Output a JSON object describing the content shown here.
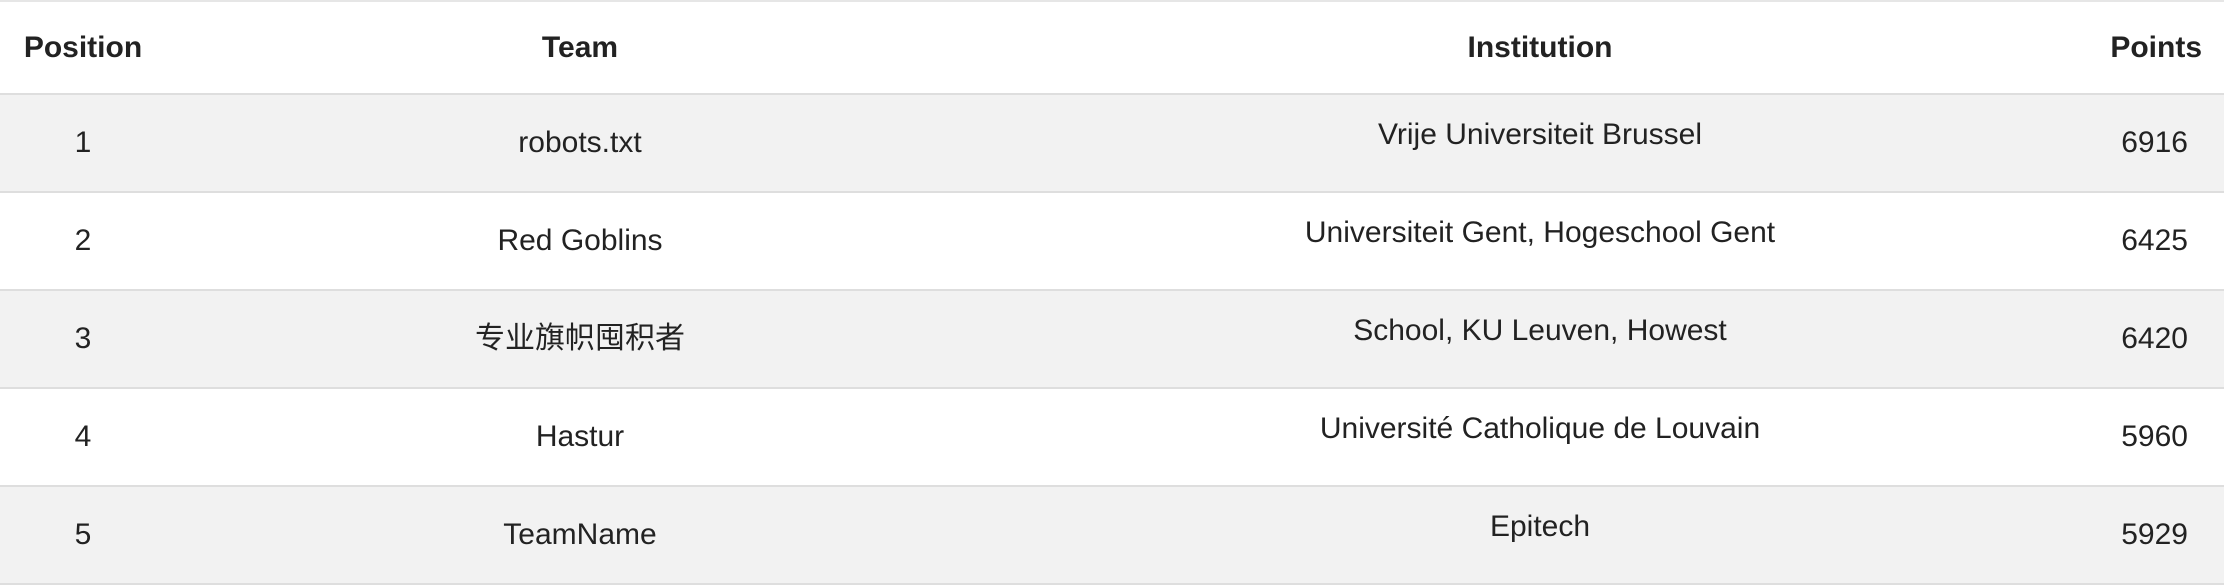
{
  "table": {
    "headers": {
      "position": "Position",
      "team": "Team",
      "institution": "Institution",
      "points": "Points"
    },
    "rows": [
      {
        "position": "1",
        "team": "robots.txt",
        "institution": "Vrije Universiteit Brussel",
        "points": "6916"
      },
      {
        "position": "2",
        "team": "Red Goblins",
        "institution": "Universiteit Gent, Hogeschool Gent",
        "points": "6425"
      },
      {
        "position": "3",
        "team": "专业旗帜囤积者",
        "institution": "School, KU Leuven, Howest",
        "points": "6420"
      },
      {
        "position": "4",
        "team": "Hastur",
        "institution": "Université Catholique de Louvain",
        "points": "5960"
      },
      {
        "position": "5",
        "team": "TeamName",
        "institution": "Epitech",
        "points": "5929"
      }
    ]
  },
  "colors": {
    "stripe": "#f2f2f2",
    "border": "#dedede",
    "text": "#222222"
  }
}
